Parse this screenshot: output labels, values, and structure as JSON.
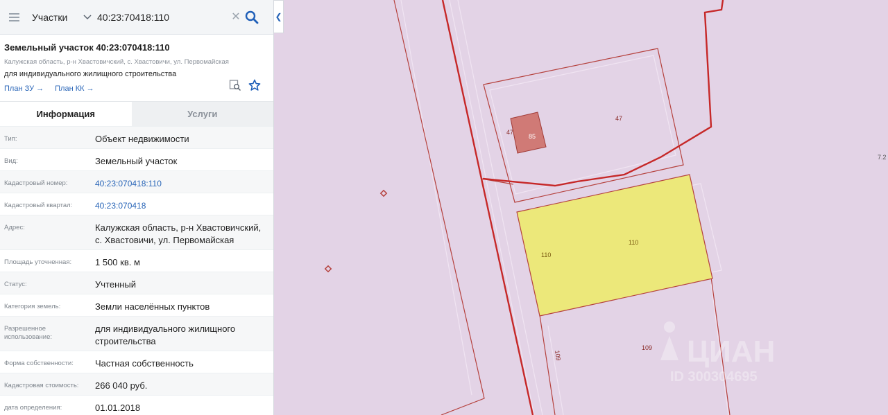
{
  "search": {
    "category": "Участки",
    "query": "40:23:70418:110"
  },
  "parcel": {
    "title": "Земельный участок 40:23:070418:110",
    "address": "Калужская область, р-н Хвастовичский, с. Хвастовичи, ул. Первомайская",
    "purpose": "для индивидуального жилищного строительства",
    "link_plan_zu": "План ЗУ →",
    "link_plan_kk": "План КК →"
  },
  "tabs": [
    {
      "label": "Информация",
      "active": true
    },
    {
      "label": "Услуги",
      "active": false
    }
  ],
  "info_rows": [
    {
      "label": "Тип:",
      "value": "Объект недвижимости"
    },
    {
      "label": "Вид:",
      "value": "Земельный участок"
    },
    {
      "label": "Кадастровый номер:",
      "value": "40:23:070418:110",
      "link": true
    },
    {
      "label": "Кадастровый квартал:",
      "value": "40:23:070418",
      "link": true
    },
    {
      "label": "Адрес:",
      "value": "Калужская область, р-н Хвастовичский, с. Хвастовичи, ул. Первомайская"
    },
    {
      "label": "Площадь уточненная:",
      "value": "1 500 кв. м"
    },
    {
      "label": "Статус:",
      "value": "Учтенный"
    },
    {
      "label": "Категория земель:",
      "value": "Земли населённых пунктов"
    },
    {
      "label": "Разрешенное использование:",
      "value": "для индивидуального жилищного строительства"
    },
    {
      "label": "Форма собственности:",
      "value": "Частная собственность"
    },
    {
      "label": "Кадастровая стоимость:",
      "value": "266 040 руб."
    },
    {
      "label": "дата определения:",
      "value": "01.01.2018"
    }
  ],
  "map": {
    "labels": {
      "parcel_47a": "47",
      "building_85": "85",
      "parcel_47b": "47",
      "parcel_110a": "110",
      "parcel_110b": "110",
      "parcel_109a": "109",
      "parcel_109b": "109",
      "edge": "7.2"
    },
    "watermark": "ЦИАН",
    "watermark_id": "ID 300304695"
  },
  "colors": {
    "accent": "#2a66b8",
    "map_background": "#e3d3e6",
    "boundary_red": "#c62828",
    "selected_parcel": "#ece87a",
    "building": "#d07a76"
  },
  "icons": {
    "menu": "menu-icon",
    "dropdown": "chevron-down-icon",
    "clear": "close-icon",
    "search": "search-icon",
    "collapse": "chevron-left-icon",
    "map_search": "map-search-icon",
    "favorite": "star-icon"
  }
}
